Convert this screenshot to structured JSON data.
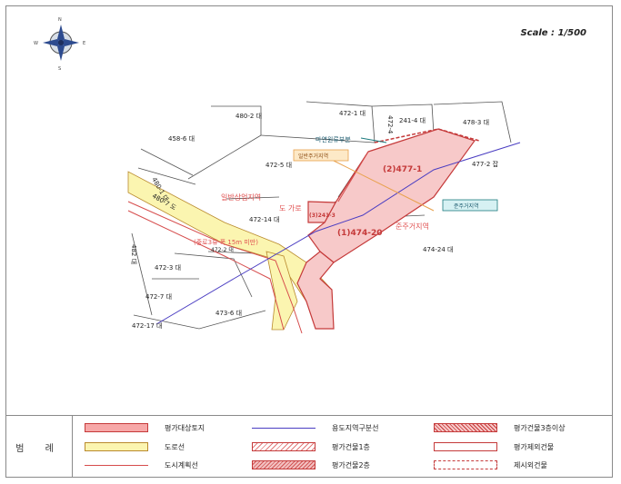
{
  "scale": "Scale : 1/500",
  "compass": {
    "n": "N",
    "s": "S",
    "e": "E",
    "w": "W"
  },
  "parcels": {
    "p480_2": "480-2 대",
    "p472_1": "472-1 대",
    "p241_4": "241-4 대",
    "p472_4": "472-4",
    "p478_3": "478-3 대",
    "p458_6": "458-6 대",
    "p472_5": "472-5 대",
    "p477_2": "477-2 잡",
    "p480_1": "480-1 대",
    "p480_7": "480-7 도",
    "p472_14": "472-14 대",
    "p474_24": "474-24 대",
    "p472_3": "472-3 대",
    "p472_7": "472-7 대",
    "p473_6": "473-6 대",
    "p472_17": "472-17 대",
    "p482": "482 대",
    "p472_2": "472-2 대"
  },
  "subjects": {
    "s1": "(1)474-20",
    "s2": "(2)477-1",
    "s3": "(3)241-3"
  },
  "zones": {
    "general_commercial": "일반상업지역",
    "semi_residential": "준주거지역",
    "road": "도 가로",
    "road_width": "(중로3류 폭 15m 미만)"
  },
  "callouts": {
    "remnant": "마연원류부분",
    "general_residential": "일반주거지역",
    "semi_residential_box": "준주거지역"
  },
  "legend": {
    "title": "범 례",
    "subject_land": "평가대상토지",
    "zoning_line": "용도지역구분선",
    "building_3": "평가건물3층이상",
    "road_line": "도로선",
    "building_1": "평가건물1층",
    "planned_building": "평가제외건물",
    "city_plan_line": "도시계획선",
    "building_2": "평가건물2층",
    "other_building": "제시외건물"
  },
  "colors": {
    "subject_fill": "#f7c9c9",
    "subject_edge": "#c53a3a",
    "road_fill": "#fbf5b0",
    "road_edge": "#b98a2e",
    "zone_line": "#4a3dc2",
    "city_plan": "#d64c4c"
  }
}
